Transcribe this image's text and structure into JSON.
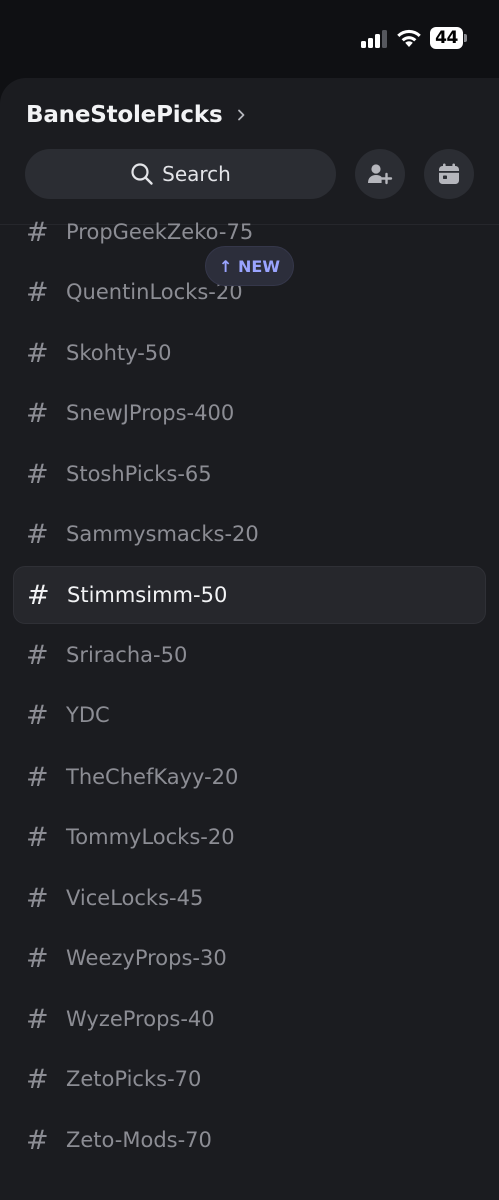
{
  "status_bar": {
    "battery_level": "44",
    "signal_bars": 3,
    "signal_bars_total": 4
  },
  "server": {
    "name": "BaneStolePicks",
    "chevron_icon": "chevron-right-icon"
  },
  "search": {
    "label": "Search",
    "icon": "search-icon"
  },
  "actions": {
    "invite_icon": "add-member-icon",
    "events_icon": "calendar-icon"
  },
  "new_pill": {
    "label": "↑ NEW"
  },
  "channels": [
    {
      "name": "PropGeekZeko-75",
      "selected": false
    },
    {
      "name": "QuentinLocks-20",
      "selected": false
    },
    {
      "name": "Skohty-50",
      "selected": false
    },
    {
      "name": "SnewJProps-400",
      "selected": false
    },
    {
      "name": "StoshPicks-65",
      "selected": false
    },
    {
      "name": "Sammysmacks-20",
      "selected": false
    },
    {
      "name": "Stimmsimm-50",
      "selected": true
    },
    {
      "name": "Sriracha-50",
      "selected": false
    },
    {
      "name": "YDC",
      "selected": false
    },
    {
      "name": "TheChefKayy-20",
      "selected": false
    },
    {
      "name": "TommyLocks-20",
      "selected": false
    },
    {
      "name": "ViceLocks-45",
      "selected": false
    },
    {
      "name": "WeezyProps-30",
      "selected": false
    },
    {
      "name": "WyzeProps-40",
      "selected": false
    },
    {
      "name": "ZetoPicks-70",
      "selected": false
    },
    {
      "name": "Zeto-Mods-70",
      "selected": false
    }
  ],
  "colors": {
    "background": "#0f1013",
    "panel": "#1b1c20",
    "control": "#2b2d33",
    "muted_text": "#8c8d94",
    "active_text": "#f2f3f5",
    "new_accent": "#9aa4ff"
  }
}
